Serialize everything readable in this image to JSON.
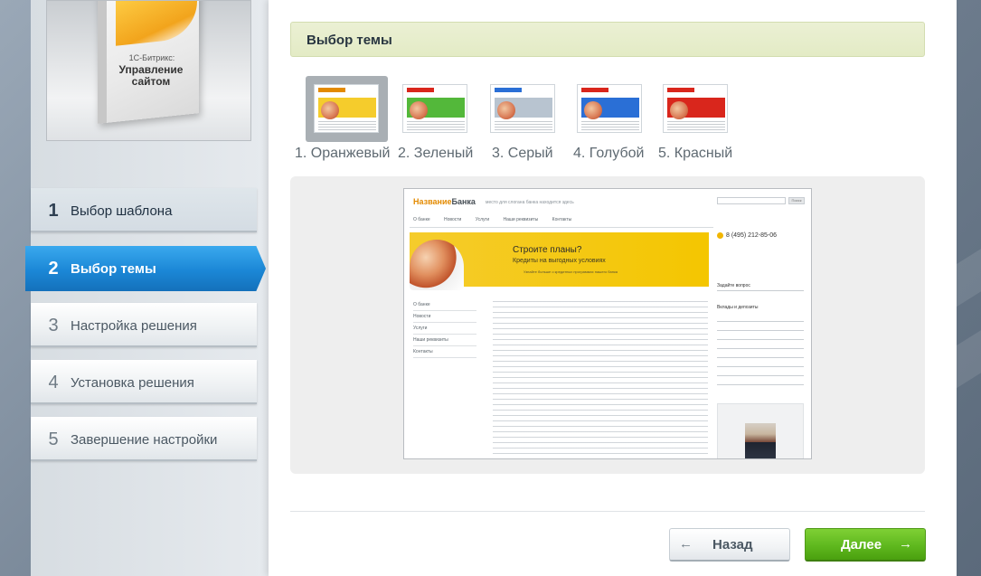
{
  "product": {
    "brand": "1С-Битрикс:",
    "title": "Управление сайтом"
  },
  "steps": [
    {
      "num": "1",
      "label": "Выбор шаблона"
    },
    {
      "num": "2",
      "label": "Выбор темы"
    },
    {
      "num": "3",
      "label": "Настройка решения"
    },
    {
      "num": "4",
      "label": "Установка решения"
    },
    {
      "num": "5",
      "label": "Завершение настройки"
    }
  ],
  "main": {
    "title": "Выбор темы"
  },
  "themes": [
    {
      "label": "1. Оранжевый",
      "color": "#f5cc2c",
      "selected": true
    },
    {
      "label": "2. Зеленый",
      "color": "#53b83a",
      "selected": false
    },
    {
      "label": "3. Серый",
      "color": "#b8c4d0",
      "selected": false
    },
    {
      "label": "4. Голубой",
      "color": "#2a6fd6",
      "selected": false
    },
    {
      "label": "5. Красный",
      "color": "#d9261c",
      "selected": false
    }
  ],
  "preview": {
    "logo_a": "Название",
    "logo_b": "Банка",
    "tagline": "место для слогана банка находится здесь",
    "search_btn": "Поиск",
    "nav": [
      "О банке",
      "Новости",
      "Услуги",
      "Наши реквизиты",
      "Контакты"
    ],
    "banner_title": "Строите планы?",
    "banner_sub": "Кредиты на выгодных условиях",
    "banner_note": "Узнайте больше о кредитных программах нашего банка",
    "left_menu": [
      "О банке",
      "Новости",
      "Услуги",
      "Наши реквизиты",
      "Контакты"
    ],
    "phone": "8 (495) 212-85-06",
    "question": "Задайте вопрос",
    "deposits": "Вклады и депозиты"
  },
  "buttons": {
    "back": "Назад",
    "next": "Далее",
    "back_arrow": "←",
    "next_arrow": "→"
  }
}
